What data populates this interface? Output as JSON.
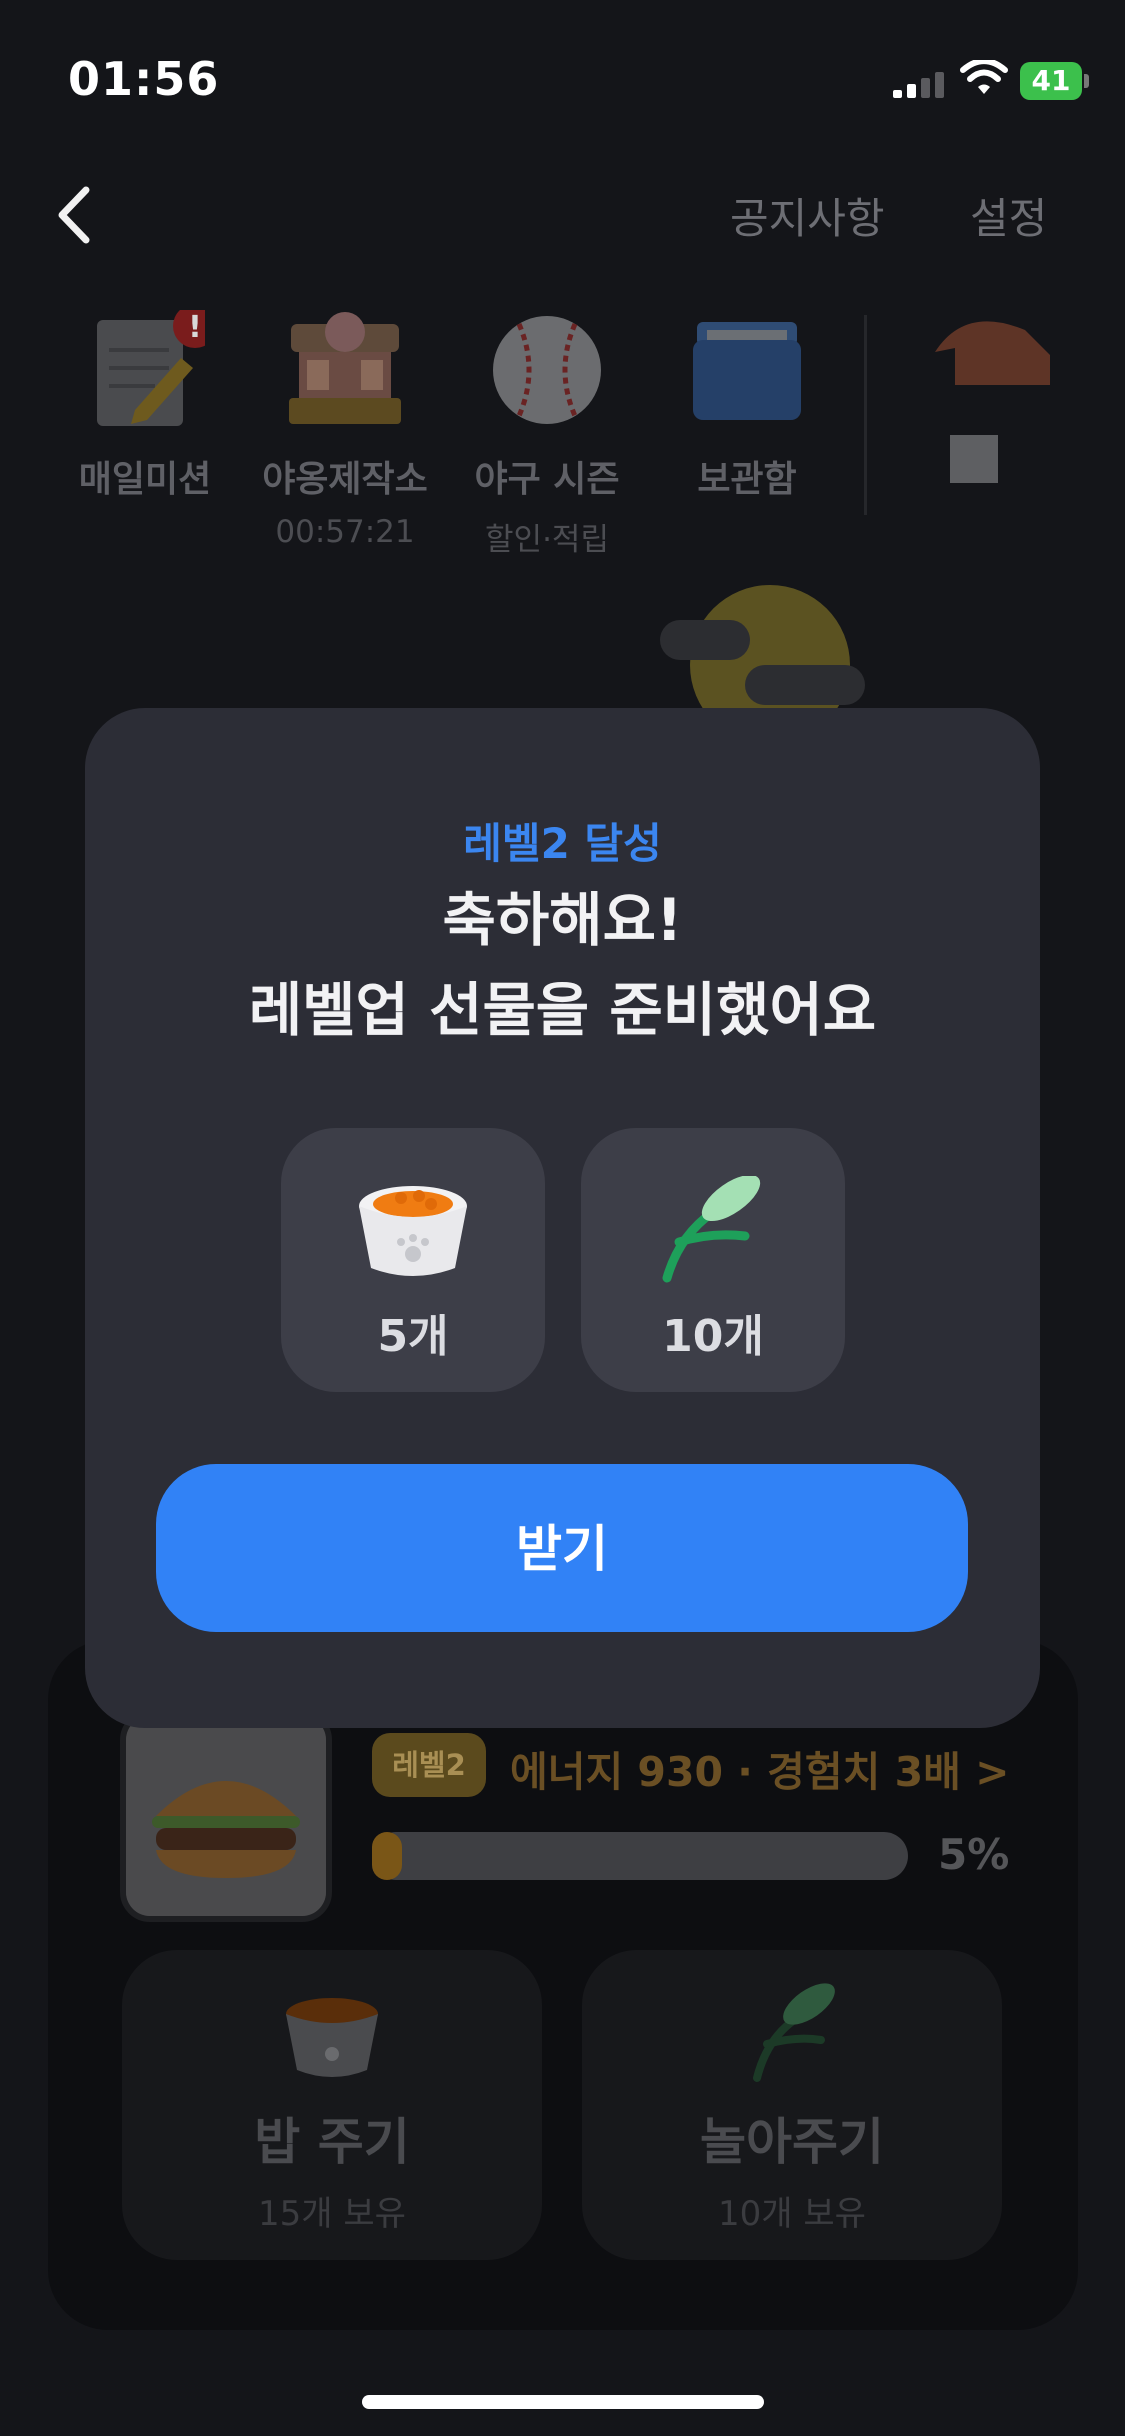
{
  "status_bar": {
    "time": "01:56",
    "battery": "41"
  },
  "nav": {
    "notice": "공지사항",
    "settings": "설정"
  },
  "shortcuts": [
    {
      "label": "매일미션",
      "sub": ""
    },
    {
      "label": "야옹제작소",
      "sub": "00:57:21"
    },
    {
      "label": "야구 시즌",
      "sub": "할인·적립"
    },
    {
      "label": "보관함",
      "sub": ""
    }
  ],
  "main": {
    "level_badge": "레벨2",
    "energy_text": "에너지 930 · 경험치 3배 >",
    "progress_percent": 5,
    "progress_label": "5%",
    "actions": [
      {
        "title": "밥 주기",
        "count": "15개 보유"
      },
      {
        "title": "놀아주기",
        "count": "10개 보유"
      }
    ]
  },
  "modal": {
    "eyebrow": "레벨2 달성",
    "title_line1": "축하해요!",
    "title_line2": "레벨업 선물을 준비했어요",
    "rewards": [
      {
        "icon": "food-bowl-icon",
        "qty": "5개"
      },
      {
        "icon": "leaf-toy-icon",
        "qty": "10개"
      }
    ],
    "button": "받기"
  },
  "colors": {
    "accent": "#3182f6",
    "modal_bg": "#2c2d36",
    "background": "#141519"
  }
}
